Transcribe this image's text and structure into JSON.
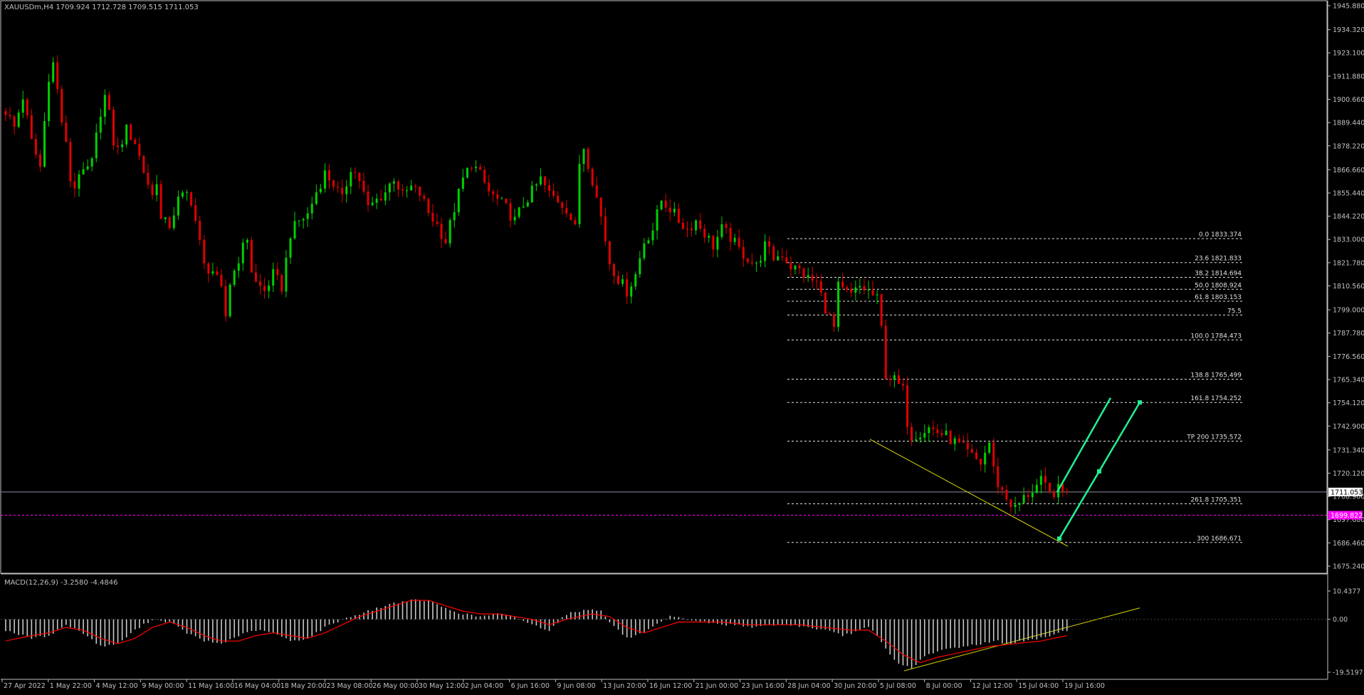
{
  "symbol_header": "XAUUSDm,H4  1709.924 1712.728 1709.515 1711.053",
  "colors": {
    "background": "#000000",
    "bull_candle": "#00d000",
    "bear_candle": "#e00000",
    "axis_text": "#c0c0c0",
    "fib_line": "#e0e0e0",
    "bid_line": "#8a8fa0",
    "magenta_line": "#ff00ff",
    "trend_line": "#d8d800",
    "projection_arrow": "#20f090",
    "macd_hist": "#c8c8c8",
    "macd_signal": "#ff0000"
  },
  "chart_data": [
    {
      "type": "candlestick",
      "symbol": "XAUUSDm",
      "timeframe": "H4",
      "header_values": {
        "open": 1709.924,
        "high": 1712.728,
        "low": 1709.515,
        "close": 1711.053
      },
      "ylim": [
        1675.24,
        1945.88
      ],
      "y_ticks": [
        "1945.880",
        "1934.320",
        "1923.100",
        "1911.880",
        "1900.660",
        "1889.440",
        "1878.220",
        "1866.660",
        "1855.440",
        "1844.220",
        "1833.000",
        "1821.780",
        "1810.560",
        "1799.000",
        "1787.780",
        "1776.560",
        "1765.340",
        "1754.120",
        "1742.900",
        "1731.340",
        "1720.120",
        "1708.900",
        "1697.680",
        "1686.460",
        "1675.240"
      ],
      "price_labels": [
        {
          "label": "1711.053",
          "value": 1711.053,
          "kind": "bid"
        },
        {
          "label": "1699.822",
          "value": 1699.822,
          "kind": "magenta"
        }
      ],
      "x_ticks": [
        "27 Apr 2022",
        "1 May 22:00",
        "4 May 12:00",
        "9 May 00:00",
        "11 May 16:00",
        "16 May 04:00",
        "18 May 20:00",
        "23 May 08:00",
        "26 May 00:00",
        "30 May 12:00",
        "2 Jun 04:00",
        "6 Jun 16:00",
        "9 Jun 08:00",
        "13 Jun 20:00",
        "16 Jun 12:00",
        "21 Jun 00:00",
        "23 Jun 16:00",
        "28 Jun 04:00",
        "30 Jun 20:00",
        "5 Jul 08:00",
        "8 Jul 00:00",
        "12 Jul 12:00",
        "15 Jul 04:00",
        "19 Jul 16:00"
      ],
      "close_path": [
        [
          0,
          1895
        ],
        [
          2,
          1887
        ],
        [
          4,
          1902
        ],
        [
          6,
          1880
        ],
        [
          8,
          1868
        ],
        [
          9,
          1890
        ],
        [
          10,
          1912
        ],
        [
          11,
          1918
        ],
        [
          12,
          1905
        ],
        [
          13,
          1890
        ],
        [
          14,
          1878
        ],
        [
          15,
          1862
        ],
        [
          16,
          1858
        ],
        [
          17,
          1866
        ],
        [
          18,
          1864
        ],
        [
          20,
          1870
        ],
        [
          22,
          1895
        ],
        [
          23,
          1902
        ],
        [
          24,
          1893
        ],
        [
          25,
          1880
        ],
        [
          26,
          1876
        ],
        [
          28,
          1886
        ],
        [
          30,
          1880
        ],
        [
          32,
          1866
        ],
        [
          34,
          1854
        ],
        [
          35,
          1862
        ],
        [
          36,
          1842
        ],
        [
          38,
          1840
        ],
        [
          40,
          1852
        ],
        [
          42,
          1855
        ],
        [
          43,
          1852
        ],
        [
          44,
          1842
        ],
        [
          46,
          1820
        ],
        [
          48,
          1818
        ],
        [
          50,
          1808
        ],
        [
          51,
          1796
        ],
        [
          52,
          1812
        ],
        [
          54,
          1824
        ],
        [
          56,
          1834
        ],
        [
          57,
          1818
        ],
        [
          58,
          1812
        ],
        [
          60,
          1808
        ],
        [
          62,
          1816
        ],
        [
          64,
          1810
        ],
        [
          66,
          1836
        ],
        [
          68,
          1842
        ],
        [
          70,
          1845
        ],
        [
          72,
          1856
        ],
        [
          74,
          1865
        ],
        [
          76,
          1860
        ],
        [
          78,
          1852
        ],
        [
          80,
          1868
        ],
        [
          82,
          1862
        ],
        [
          84,
          1848
        ],
        [
          86,
          1852
        ],
        [
          88,
          1856
        ],
        [
          90,
          1863
        ],
        [
          92,
          1854
        ],
        [
          94,
          1858
        ],
        [
          96,
          1855
        ],
        [
          98,
          1846
        ],
        [
          100,
          1840
        ],
        [
          102,
          1832
        ],
        [
          104,
          1848
        ],
        [
          106,
          1862
        ],
        [
          108,
          1870
        ],
        [
          110,
          1864
        ],
        [
          112,
          1856
        ],
        [
          114,
          1852
        ],
        [
          116,
          1848
        ],
        [
          118,
          1842
        ],
        [
          120,
          1850
        ],
        [
          122,
          1856
        ],
        [
          124,
          1862
        ],
        [
          126,
          1855
        ],
        [
          128,
          1852
        ],
        [
          130,
          1848
        ],
        [
          132,
          1838
        ],
        [
          133,
          1870
        ],
        [
          134,
          1878
        ],
        [
          136,
          1862
        ],
        [
          138,
          1844
        ],
        [
          140,
          1822
        ],
        [
          142,
          1814
        ],
        [
          144,
          1808
        ],
        [
          146,
          1816
        ],
        [
          148,
          1832
        ],
        [
          150,
          1838
        ],
        [
          152,
          1852
        ],
        [
          154,
          1848
        ],
        [
          156,
          1842
        ],
        [
          158,
          1838
        ],
        [
          160,
          1842
        ],
        [
          162,
          1836
        ],
        [
          164,
          1830
        ],
        [
          166,
          1838
        ],
        [
          168,
          1834
        ],
        [
          170,
          1828
        ],
        [
          172,
          1824
        ],
        [
          174,
          1820
        ],
        [
          176,
          1830
        ],
        [
          178,
          1824
        ],
        [
          180,
          1826
        ],
        [
          182,
          1820
        ],
        [
          184,
          1818
        ],
        [
          186,
          1814
        ],
        [
          188,
          1812
        ],
        [
          190,
          1800
        ],
        [
          192,
          1790
        ],
        [
          193,
          1810
        ],
        [
          194,
          1808
        ],
        [
          196,
          1806
        ],
        [
          198,
          1810
        ],
        [
          200,
          1808
        ],
        [
          202,
          1804
        ],
        [
          203,
          1790
        ],
        [
          204,
          1768
        ],
        [
          206,
          1765
        ],
        [
          208,
          1760
        ],
        [
          209,
          1745
        ],
        [
          210,
          1738
        ],
        [
          212,
          1740
        ],
        [
          214,
          1742
        ],
        [
          216,
          1740
        ],
        [
          218,
          1738
        ],
        [
          220,
          1735
        ],
        [
          222,
          1732
        ],
        [
          224,
          1728
        ],
        [
          226,
          1725
        ],
        [
          228,
          1735
        ],
        [
          229,
          1722
        ],
        [
          230,
          1715
        ],
        [
          232,
          1708
        ],
        [
          234,
          1703
        ],
        [
          236,
          1708
        ],
        [
          238,
          1712
        ],
        [
          240,
          1716
        ],
        [
          242,
          1710
        ],
        [
          244,
          1712
        ],
        [
          246,
          1710
        ]
      ]
    },
    {
      "type": "fibonacci",
      "levels": [
        {
          "label": "0.0 1833.374",
          "value": 1833.374
        },
        {
          "label": "23.6 1821.833",
          "value": 1821.833
        },
        {
          "label": "38.2 1814.694",
          "value": 1814.694
        },
        {
          "label": "50.0 1808.924",
          "value": 1808.924
        },
        {
          "label": "61.8 1803.153",
          "value": 1803.153
        },
        {
          "label": "75.5",
          "value": 1796.5
        },
        {
          "label": "100.0 1784.473",
          "value": 1784.473
        },
        {
          "label": "138.8 1765.499",
          "value": 1765.499
        },
        {
          "label": "161.8 1754.252",
          "value": 1754.252
        },
        {
          "label": "TP 200 1735.572",
          "value": 1735.572
        },
        {
          "label": "261.8 1705.351",
          "value": 1705.351
        },
        {
          "label": "300 1686.671",
          "value": 1686.671
        }
      ]
    },
    {
      "type": "bar",
      "name": "MACD",
      "label": "MACD(12,26,9) -3.2580 -4.4846",
      "ylim": [
        -19.5197,
        10.4377
      ],
      "y_ticks": [
        "10.4377",
        "0.00",
        "-19.5197"
      ],
      "histogram_path": [
        [
          0,
          -4
        ],
        [
          6,
          -7
        ],
        [
          10,
          -6
        ],
        [
          14,
          -2
        ],
        [
          18,
          -5
        ],
        [
          22,
          -10
        ],
        [
          26,
          -9
        ],
        [
          30,
          -4
        ],
        [
          34,
          0
        ],
        [
          38,
          -1
        ],
        [
          42,
          -5
        ],
        [
          46,
          -8
        ],
        [
          50,
          -9
        ],
        [
          54,
          -6
        ],
        [
          58,
          -4
        ],
        [
          62,
          -5
        ],
        [
          66,
          -8
        ],
        [
          70,
          -7
        ],
        [
          74,
          -3
        ],
        [
          78,
          0
        ],
        [
          82,
          2
        ],
        [
          86,
          4
        ],
        [
          90,
          6
        ],
        [
          94,
          7
        ],
        [
          98,
          7
        ],
        [
          102,
          4
        ],
        [
          106,
          2
        ],
        [
          110,
          1
        ],
        [
          114,
          2
        ],
        [
          118,
          1
        ],
        [
          122,
          -2
        ],
        [
          126,
          -4
        ],
        [
          130,
          2
        ],
        [
          133,
          3
        ],
        [
          136,
          4
        ],
        [
          138,
          3
        ],
        [
          140,
          -1
        ],
        [
          144,
          -7
        ],
        [
          148,
          -5
        ],
        [
          152,
          -1
        ],
        [
          154,
          1
        ],
        [
          158,
          0
        ],
        [
          162,
          -1
        ],
        [
          166,
          -2
        ],
        [
          170,
          -2
        ],
        [
          174,
          -3
        ],
        [
          178,
          -2
        ],
        [
          182,
          -2
        ],
        [
          186,
          -3
        ],
        [
          190,
          -4
        ],
        [
          194,
          -6
        ],
        [
          196,
          -5
        ],
        [
          198,
          -4
        ],
        [
          200,
          -3
        ],
        [
          202,
          -6
        ],
        [
          204,
          -11
        ],
        [
          206,
          -15
        ],
        [
          208,
          -17
        ],
        [
          210,
          -18
        ],
        [
          212,
          -15
        ],
        [
          214,
          -13
        ],
        [
          218,
          -11
        ],
        [
          222,
          -10
        ],
        [
          226,
          -9
        ],
        [
          230,
          -8
        ],
        [
          232,
          -9
        ],
        [
          236,
          -8
        ],
        [
          240,
          -7
        ],
        [
          244,
          -5
        ],
        [
          246,
          -4
        ]
      ],
      "signal_path": [
        [
          0,
          -8
        ],
        [
          6,
          -6
        ],
        [
          10,
          -5
        ],
        [
          14,
          -3
        ],
        [
          18,
          -4
        ],
        [
          22,
          -7
        ],
        [
          26,
          -9
        ],
        [
          30,
          -7
        ],
        [
          34,
          -3
        ],
        [
          38,
          -1
        ],
        [
          42,
          -3
        ],
        [
          46,
          -6
        ],
        [
          50,
          -8
        ],
        [
          54,
          -8
        ],
        [
          58,
          -6
        ],
        [
          62,
          -5
        ],
        [
          66,
          -6
        ],
        [
          70,
          -7
        ],
        [
          74,
          -5
        ],
        [
          78,
          -2
        ],
        [
          82,
          1
        ],
        [
          86,
          3
        ],
        [
          90,
          5
        ],
        [
          94,
          7
        ],
        [
          98,
          7
        ],
        [
          102,
          5
        ],
        [
          106,
          3
        ],
        [
          110,
          2
        ],
        [
          114,
          2
        ],
        [
          118,
          1
        ],
        [
          122,
          0
        ],
        [
          126,
          -2
        ],
        [
          130,
          0
        ],
        [
          136,
          2
        ],
        [
          140,
          1
        ],
        [
          144,
          -3
        ],
        [
          148,
          -5
        ],
        [
          152,
          -3
        ],
        [
          156,
          -1
        ],
        [
          160,
          -1
        ],
        [
          166,
          -1
        ],
        [
          172,
          -2
        ],
        [
          178,
          -2
        ],
        [
          184,
          -2
        ],
        [
          190,
          -3
        ],
        [
          196,
          -4
        ],
        [
          200,
          -4
        ],
        [
          204,
          -8
        ],
        [
          208,
          -13
        ],
        [
          212,
          -16
        ],
        [
          216,
          -14
        ],
        [
          222,
          -12
        ],
        [
          228,
          -10
        ],
        [
          234,
          -9
        ],
        [
          240,
          -8
        ],
        [
          246,
          -6
        ]
      ]
    }
  ]
}
